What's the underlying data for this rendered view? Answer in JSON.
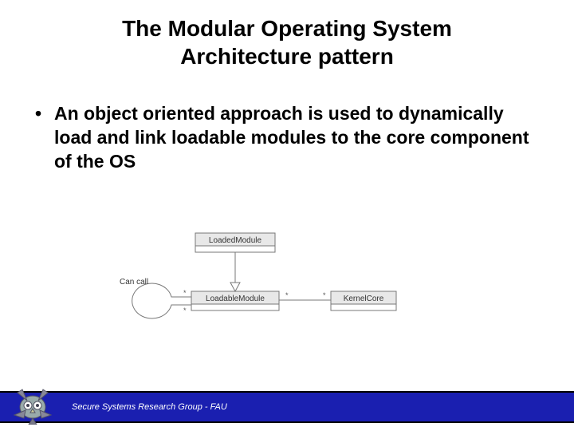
{
  "title_line1": "The Modular Operating System",
  "title_line2": "Architecture pattern",
  "bullet1": "An object oriented approach is used to dynamically load and link loadable modules to the core component of the OS",
  "diagram": {
    "loaded_module": "LoadedModule",
    "loadable_module": "LoadableModule",
    "kernel_core": "KernelCore",
    "can_call": "Can call",
    "star": "*"
  },
  "footer": "Secure Systems Research Group - FAU"
}
